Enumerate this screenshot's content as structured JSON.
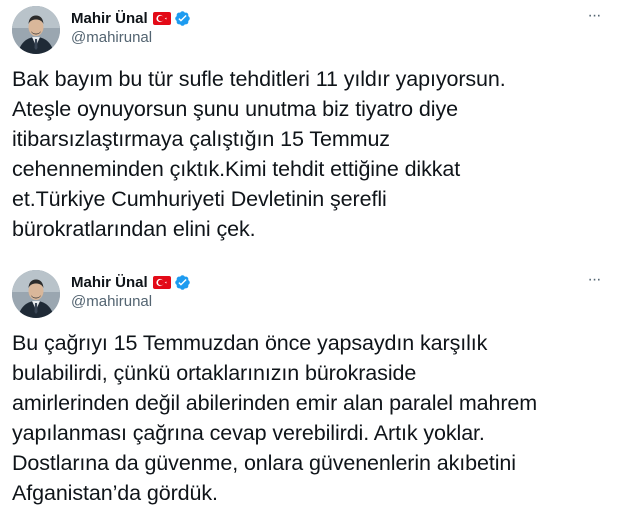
{
  "colors": {
    "text_primary": "#0f1419",
    "text_secondary": "#536471",
    "verified_blue": "#1d9bf0",
    "flag_red": "#e30a17",
    "divider": "#eff3f4"
  },
  "icons": {
    "flag": "turkey-flag-icon",
    "verified": "verified-badge-icon",
    "more": "more-options-icon"
  },
  "tweets": [
    {
      "author": {
        "name": "Mahir Ünal",
        "handle": "@mahirunal"
      },
      "more_label": "···",
      "text_lines": [
        "Bak bayım bu tür sufle tehditleri 11 yıldır yapıyorsun.",
        "Ateşle oynuyorsun şunu unutma biz tiyatro diye",
        "itibarsızlaştırmaya çalıştığın 15 Temmuz",
        "cehenneminden çıktık.Kimi tehdit ettiğine dikkat",
        "et.Türkiye Cumhuriyeti Devletinin şerefli",
        "bürokratlarından elini çek."
      ]
    },
    {
      "author": {
        "name": "Mahir Ünal",
        "handle": "@mahirunal"
      },
      "more_label": "···",
      "text_lines": [
        "Bu çağrıyı 15 Temmuzdan önce yapsaydın karşılık",
        "bulabilirdi, çünkü ortaklarınızın bürokraside",
        "amirlerinden değil abilerinden emir alan paralel mahrem",
        "yapılanması çağrına cevap verebilirdi. Artık yoklar.",
        "Dostlarına da güvenme, onlara güvenenlerin akıbetini",
        "Afganistan’da gördük."
      ]
    }
  ]
}
